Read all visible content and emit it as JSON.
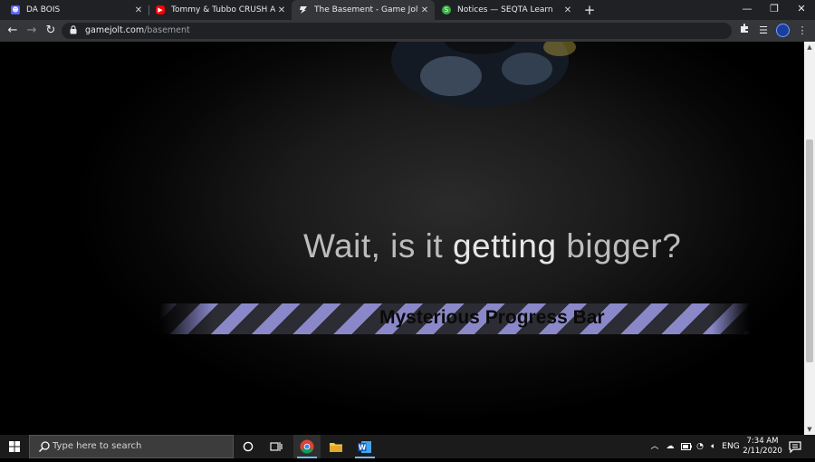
{
  "browser": {
    "tabs": [
      {
        "title": "DA BOIS",
        "favicon": "discord-icon",
        "active": false
      },
      {
        "title": "Tommy & Tubbo CRUSH AMONG",
        "favicon": "youtube-icon",
        "active": false
      },
      {
        "title": "The Basement - Game Jolt",
        "favicon": "gamejolt-icon",
        "active": true
      },
      {
        "title": "Notices — SEQTA Learn",
        "favicon": "seqta-icon",
        "active": false
      }
    ],
    "new_tab_label": "+",
    "address": {
      "host": "gamejolt.com",
      "path": "/basement"
    }
  },
  "page": {
    "heading_start": "Wait, is it ",
    "heading_mid": "getting",
    "heading_end": " bigger?",
    "progress_label": "Mysterious Progress Bar",
    "stripe_color": "#8a88c8"
  },
  "taskbar": {
    "search_placeholder": "Type here to search",
    "language": "ENG",
    "time": "7:34 AM",
    "date": "2/11/2020",
    "accent_color": "#76b9ed"
  }
}
